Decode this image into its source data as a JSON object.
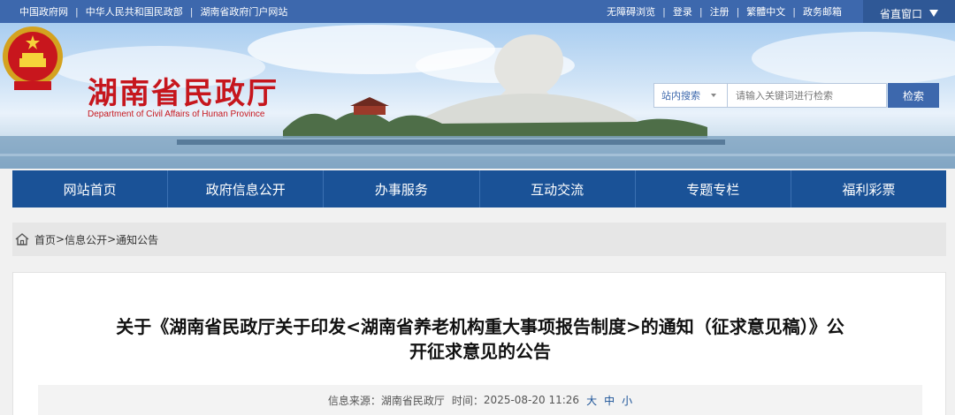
{
  "topbar": {
    "left_links": [
      "中国政府网",
      "中华人民共和国民政部",
      "湖南省政府门户网站"
    ],
    "right_links": [
      "无障碍浏览",
      "登录",
      "注册",
      "繁體中文",
      "政务邮箱"
    ],
    "window_button": "省直窗口"
  },
  "header": {
    "site_name": "湖南省民政厅",
    "site_name_en": "Department of Civil Affairs of Hunan Province"
  },
  "search": {
    "scope": "站内搜索",
    "placeholder": "请输入关键词进行检索",
    "button": "检索"
  },
  "nav": {
    "items": [
      "网站首页",
      "政府信息公开",
      "办事服务",
      "互动交流",
      "专题专栏",
      "福利彩票"
    ]
  },
  "breadcrumb": {
    "items": [
      "首页",
      "信息公开",
      "通知公告"
    ]
  },
  "article": {
    "title_line1": "关于《湖南省民政厅关于印发<湖南省养老机构重大事项报告制度>的通知（征求意见稿）》公",
    "title_line2": "开征求意见的公告",
    "source_label": "信息来源：",
    "source": "湖南省民政厅",
    "time_label": "时间：",
    "time": "2025-08-20 11:26",
    "size_large": "大",
    "size_medium": "中",
    "size_small": "小"
  },
  "colors": {
    "topbar": "#3d68ad",
    "nav": "#1a5297",
    "title_red": "#c6161d"
  }
}
